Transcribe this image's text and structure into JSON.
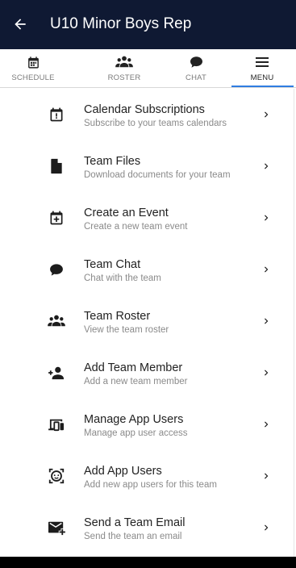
{
  "appbar": {
    "title": "U10 Minor Boys Rep",
    "back_icon": "arrow-back-icon"
  },
  "tabs": [
    {
      "label": "SCHEDULE",
      "icon": "calendar-icon",
      "active": false
    },
    {
      "label": "ROSTER",
      "icon": "people-icon",
      "active": false
    },
    {
      "label": "CHAT",
      "icon": "chat-bubble-icon",
      "active": false
    },
    {
      "label": "MENU",
      "icon": "hamburger-menu-icon",
      "active": true
    }
  ],
  "menu": {
    "items": [
      {
        "title": "Calendar Subscriptions",
        "subtitle": "Subscribe to your teams calendars",
        "icon": "calendar-alert-icon"
      },
      {
        "title": "Team Files",
        "subtitle": "Download documents for your team",
        "icon": "file-icon"
      },
      {
        "title": "Create an Event",
        "subtitle": "Create a new team event",
        "icon": "calendar-plus-icon"
      },
      {
        "title": "Team Chat",
        "subtitle": "Chat with the team",
        "icon": "chat-bubble-icon"
      },
      {
        "title": "Team Roster",
        "subtitle": "View the team roster",
        "icon": "people-icon"
      },
      {
        "title": "Add Team Member",
        "subtitle": "Add a new team member",
        "icon": "person-add-icon"
      },
      {
        "title": "Manage App Users",
        "subtitle": "Manage app user access",
        "icon": "devices-icon"
      },
      {
        "title": "Add App Users",
        "subtitle": "Add new app users for this team",
        "icon": "face-frame-icon"
      },
      {
        "title": "Send a Team Email",
        "subtitle": "Send the team an email",
        "icon": "email-plus-icon"
      }
    ]
  },
  "colors": {
    "appbar_bg": "#0f1933",
    "active_tab_indicator": "#2f7de1",
    "icon_color": "#1c1c1c"
  }
}
